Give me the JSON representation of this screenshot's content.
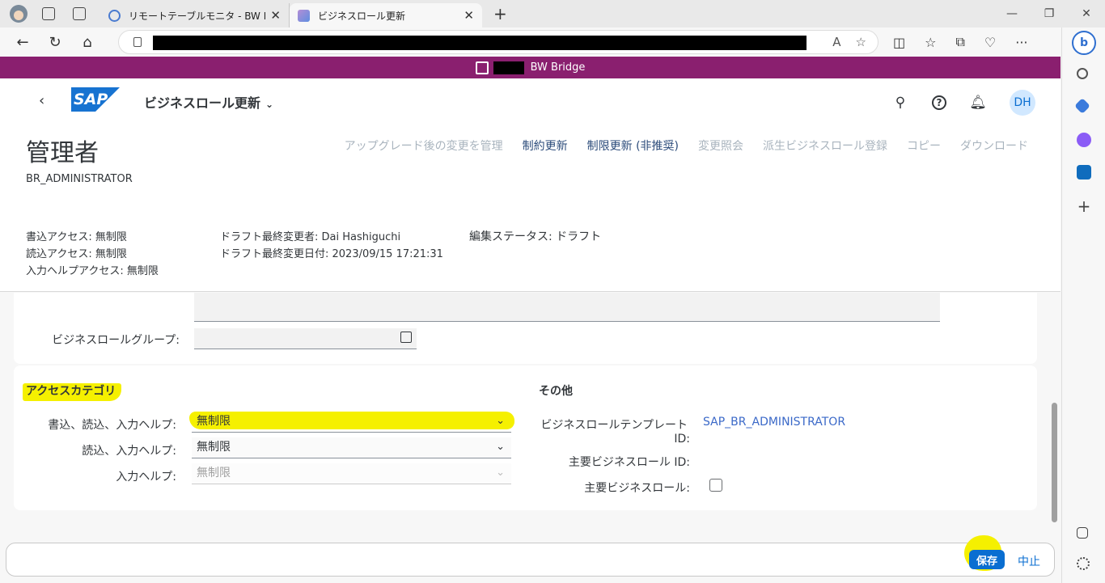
{
  "browser": {
    "tabs": [
      {
        "title": "リモートテーブルモニタ - BW Bridge (S",
        "active": false
      },
      {
        "title": "ビジネスロール更新",
        "active": true
      }
    ],
    "new_tab": "+",
    "window_controls": [
      "—",
      "❐",
      "✕"
    ],
    "nav": {
      "back": "←",
      "reload": "↻",
      "home": "⌂"
    },
    "url_icons": [
      "A",
      "☆"
    ],
    "tools": [
      "◫",
      "☆",
      "⧉",
      "♡",
      "···"
    ],
    "copilot": "b"
  },
  "system": {
    "name": "BW Bridge"
  },
  "shell": {
    "app_title": "ビジネスロール更新",
    "logo": "SAP",
    "avatar": "DH",
    "icons": [
      "search-icon",
      "help-icon",
      "bell-icon"
    ]
  },
  "object": {
    "title": "管理者",
    "subtitle": "BR_ADMINISTRATOR",
    "actions": [
      {
        "label": "アップグレード後の変更を管理",
        "enabled": false
      },
      {
        "label": "制約更新",
        "enabled": true
      },
      {
        "label": "制限更新 (非推奨)",
        "enabled": true
      },
      {
        "label": "変更照会",
        "enabled": false
      },
      {
        "label": "派生ビジネスロール登録",
        "enabled": false
      },
      {
        "label": "コピー",
        "enabled": false
      },
      {
        "label": "ダウンロード",
        "enabled": false
      }
    ],
    "header": {
      "col1": [
        "書込アクセス: 無制限",
        "読込アクセス: 無制限",
        "入力ヘルプアクセス: 無制限"
      ],
      "col2": [
        "ドラフト最終変更者: Dai Hashiguchi",
        "ドラフト最終変更日付: 2023/09/15 17:21:31"
      ],
      "col3": [
        "編集ステータス: ドラフト"
      ]
    }
  },
  "general": {
    "business_role_group_label": "ビジネスロールグループ:",
    "business_role_group_value": ""
  },
  "access": {
    "title": "アクセスカテゴリ",
    "fields": [
      {
        "label": "書込、読込、入力ヘルプ:",
        "value": "無制限",
        "enabled": true
      },
      {
        "label": "読込、入力ヘルプ:",
        "value": "無制限",
        "enabled": true
      },
      {
        "label": "入力ヘルプ:",
        "value": "無制限",
        "enabled": false
      }
    ]
  },
  "other": {
    "title": "その他",
    "template_label_1": "ビジネスロールテンプレート",
    "template_label_2": "ID:",
    "template_value": "SAP_BR_ADMINISTRATOR",
    "main_role_id_label": "主要ビジネスロール ID:",
    "main_role_label": "主要ビジネスロール:",
    "main_role_checked": false
  },
  "footer": {
    "save": "保存",
    "cancel": "中止"
  },
  "colors": {
    "system_bar": "#8a1f6f",
    "highlight": "#f5f000",
    "accent": "#0a6ed1"
  }
}
